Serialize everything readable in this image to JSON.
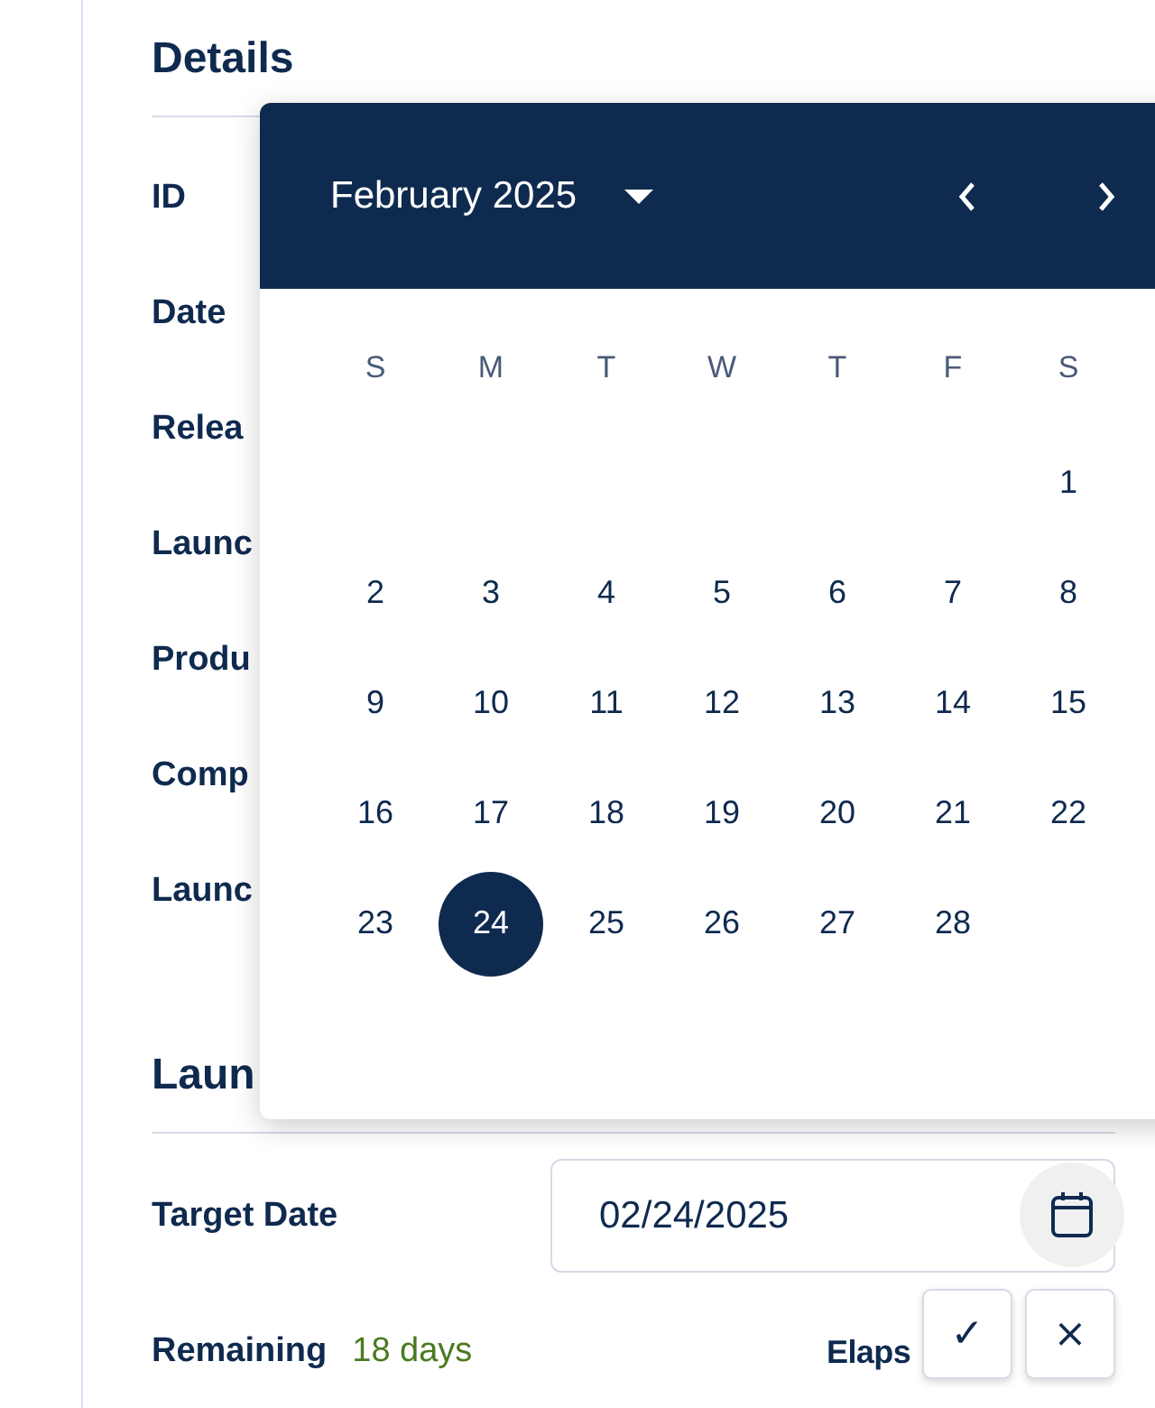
{
  "details": {
    "title": "Details",
    "rows": [
      {
        "label": "ID"
      },
      {
        "label": "Date"
      },
      {
        "label": "Relea"
      },
      {
        "label": "Launc"
      },
      {
        "label": "Produ"
      },
      {
        "label": "Comp"
      },
      {
        "label": "Launc"
      }
    ]
  },
  "launch": {
    "title": "Laun",
    "target_date": {
      "label": "Target Date",
      "value": "02/24/2025"
    },
    "remaining": {
      "label": "Remaining",
      "value": "18 days"
    },
    "elapsed": {
      "label": "Elaps"
    }
  },
  "actions": [
    "✓",
    "×"
  ],
  "calendar": {
    "month": "February 2025",
    "weekdays": [
      "S",
      "M",
      "T",
      "W",
      "T",
      "F",
      "S"
    ],
    "weeks": [
      [
        {
          "label": "1",
          "selected": false
        }
      ],
      [
        {
          "label": "2",
          "selected": false
        },
        {
          "label": "3",
          "selected": false
        },
        {
          "label": "4",
          "selected": false
        },
        {
          "label": "5",
          "selected": false
        },
        {
          "label": "6",
          "selected": false
        },
        {
          "label": "7",
          "selected": false
        },
        {
          "label": "8",
          "selected": false
        }
      ],
      [
        {
          "label": "9",
          "selected": false
        },
        {
          "label": "10",
          "selected": false
        },
        {
          "label": "11",
          "selected": false
        },
        {
          "label": "12",
          "selected": false
        },
        {
          "label": "13",
          "selected": false
        },
        {
          "label": "14",
          "selected": false
        },
        {
          "label": "15",
          "selected": false
        }
      ],
      [
        {
          "label": "16",
          "selected": false
        },
        {
          "label": "17",
          "selected": false
        },
        {
          "label": "18",
          "selected": false
        },
        {
          "label": "19",
          "selected": false
        },
        {
          "label": "20",
          "selected": false
        },
        {
          "label": "21",
          "selected": false
        },
        {
          "label": "22",
          "selected": false
        }
      ],
      [
        {
          "label": "23",
          "selected": false
        },
        {
          "label": "24",
          "selected": true
        },
        {
          "label": "25",
          "selected": false
        },
        {
          "label": "26",
          "selected": false
        },
        {
          "label": "27",
          "selected": false
        },
        {
          "label": "28",
          "selected": false
        }
      ]
    ]
  }
}
